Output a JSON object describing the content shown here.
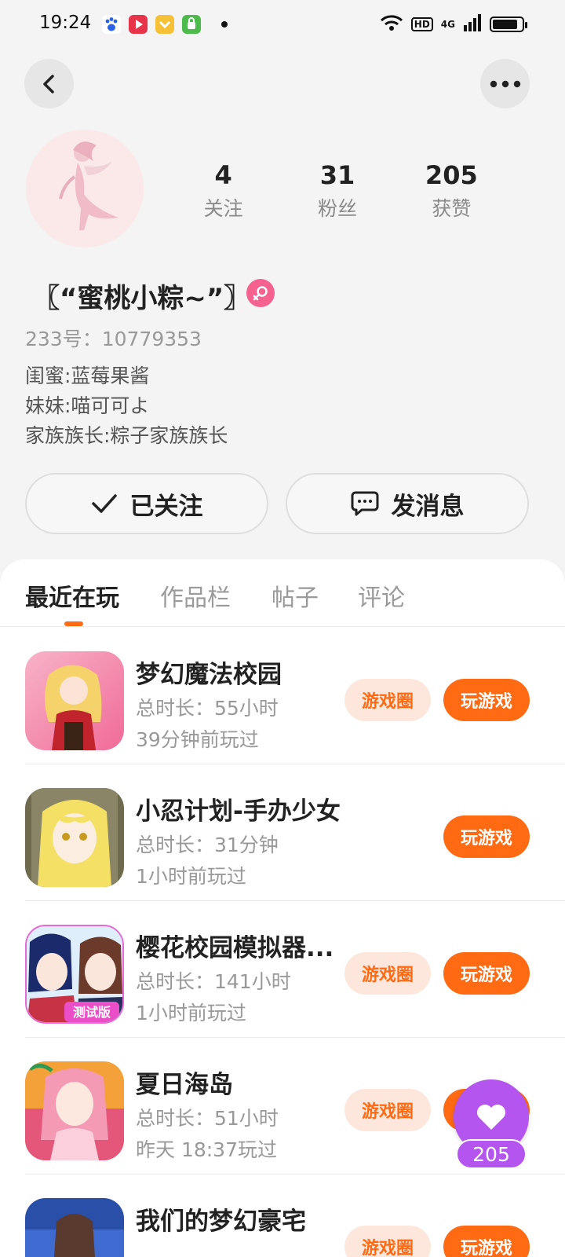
{
  "status_bar": {
    "time": "19:24",
    "network_label": "4G",
    "hd_label": "HD",
    "battery_level": 0.85,
    "app_icons": [
      "baidu-paw-icon",
      "video-play-icon",
      "wallet-icon",
      "shopping-bag-icon"
    ]
  },
  "header": {
    "back_icon": "chevron-left-icon",
    "more_icon": "more-dots-icon"
  },
  "profile": {
    "stats": [
      {
        "value": "4",
        "label": "关注"
      },
      {
        "value": "31",
        "label": "粉丝"
      },
      {
        "value": "205",
        "label": "获赞"
      }
    ],
    "nickname": "〖“蜜桃小粽~”〗",
    "gender": "female",
    "uid_text": "233号：10779353",
    "bio_lines": [
      "闺蜜:蓝莓果酱",
      "妹妹:喵可可よ",
      "家族族长:粽子家族族长"
    ],
    "follow_label": "已关注",
    "message_label": "发消息"
  },
  "tabs": [
    {
      "label": "最近在玩",
      "active": true
    },
    {
      "label": "作品栏",
      "active": false
    },
    {
      "label": "帖子",
      "active": false
    },
    {
      "label": "评论",
      "active": false
    }
  ],
  "games": [
    {
      "title": "梦幻魔法校园",
      "duration": "总时长：55小时",
      "last_played": "39分钟前玩过",
      "circle_label": "游戏圈",
      "play_label": "玩游戏",
      "has_circle": true
    },
    {
      "title": "小忍计划-手办少女",
      "duration": "总时长：31分钟",
      "last_played": "1小时前玩过",
      "circle_label": "",
      "play_label": "玩游戏",
      "has_circle": false
    },
    {
      "title": "樱花校园模拟器...",
      "duration": "总时长：141小时",
      "last_played": "1小时前玩过",
      "circle_label": "游戏圈",
      "play_label": "玩游戏",
      "has_circle": true,
      "icon_caption": "测试版"
    },
    {
      "title": "夏日海岛",
      "duration": "总时长：51小时",
      "last_played": "昨天 18:37玩过",
      "circle_label": "游戏圈",
      "play_label": "玩游戏",
      "has_circle": true
    },
    {
      "title": "我们的梦幻豪宅",
      "duration": "",
      "last_played": "",
      "circle_label": "游戏圈",
      "play_label": "玩游戏",
      "has_circle": true
    }
  ],
  "like_float": {
    "count": "205",
    "icon": "heart-icon"
  },
  "colors": {
    "accent": "#ff6a13",
    "circle_bg": "#fde7dc",
    "like_purple": "#b455f0",
    "gender_pink": "#f5628f"
  }
}
